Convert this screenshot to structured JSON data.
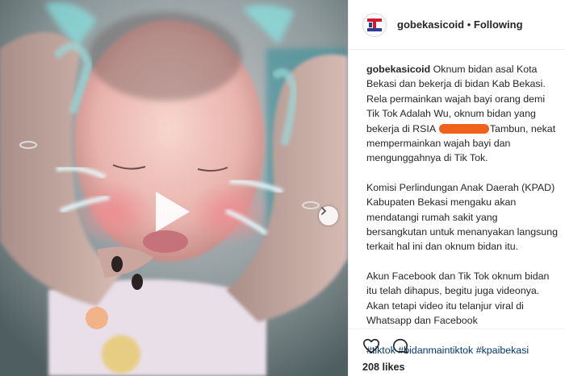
{
  "post": {
    "username": "gobekasicoid",
    "separator": "•",
    "follow_status": "Following",
    "caption": {
      "username": "gobekasicoid",
      "paragraph1_before": "Oknum bidan asal Kota Bekasi dan bekerja di bidan Kab Bekasi. Rela permainkan wajah bayi orang demi Tik Tok Adalah Wu, oknum bidan yang bekerja di RSIA",
      "paragraph1_after": "Tambun, nekat mempermainkan wajah bayi dan mengunggahnya di Tik Tok.",
      "paragraph2": "Komisi Perlindungan Anak Daerah (KPAD) Kabupaten Bekasi mengaku akan mendatangi rumah sakit yang bersangkutan untuk menanyakan langsung terkait hal ini dan oknum bidan itu.",
      "paragraph3": "Akun Facebook dan Tik Tok oknum bidan itu telah dihapus, begitu juga videonya. Akan tetapi video itu telanjur viral di Whatsapp dan Facebook"
    },
    "hashtags": [
      "#tiktok",
      "#bidanmaintiktok",
      "#kpaibekasi"
    ],
    "likes": "208 likes"
  },
  "icons": {
    "play": "play-icon",
    "next": "chevron-right-icon",
    "like": "heart-icon",
    "comment": "comment-icon",
    "avatar": "brand-logo-icon"
  },
  "colors": {
    "redaction": "#f0621c",
    "hashtag": "#00376b",
    "text": "#262626"
  }
}
